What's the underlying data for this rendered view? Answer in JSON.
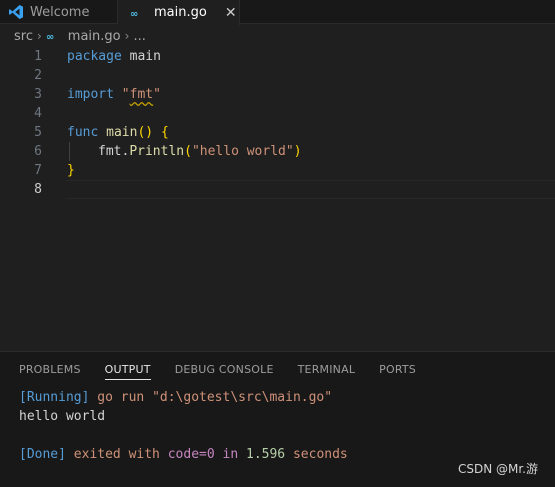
{
  "tabs": [
    {
      "label": "Welcome",
      "icon": "vscode-icon",
      "active": false
    },
    {
      "label": "main.go",
      "icon": "go-file-icon",
      "active": true,
      "close": "✕"
    }
  ],
  "breadcrumb": {
    "folder": "src",
    "file": "main.go",
    "more": "..."
  },
  "editor": {
    "line_numbers": [
      "1",
      "2",
      "3",
      "4",
      "5",
      "6",
      "7",
      "8"
    ],
    "current_line": 8,
    "line1": {
      "kw": "package",
      "name": " main"
    },
    "line3": {
      "kw": "import",
      "space": " ",
      "q1": "\"",
      "pkg": "fmt",
      "q2": "\""
    },
    "line5": {
      "kw": "func",
      "name": " main",
      "paren": "()",
      "space": " ",
      "brace": "{"
    },
    "line6": {
      "obj": "fmt.",
      "fn": "Println",
      "open": "(",
      "str": "\"hello world\"",
      "close": ")"
    },
    "line7": {
      "brace": "}"
    }
  },
  "panel": {
    "tabs": [
      "PROBLEMS",
      "OUTPUT",
      "DEBUG CONSOLE",
      "TERMINAL",
      "PORTS"
    ],
    "active_tab": "OUTPUT",
    "output": {
      "running_tag": "[Running]",
      "running_cmd": " go run \"d:\\gotest\\src\\main.go\"",
      "program_out": "hello world",
      "done_tag": "[Done]",
      "done_exited": " exited with ",
      "done_code": "code=0",
      "done_in": " in ",
      "done_time": "1.596",
      "done_seconds": " seconds"
    }
  },
  "watermark": "CSDN @Mr.游"
}
